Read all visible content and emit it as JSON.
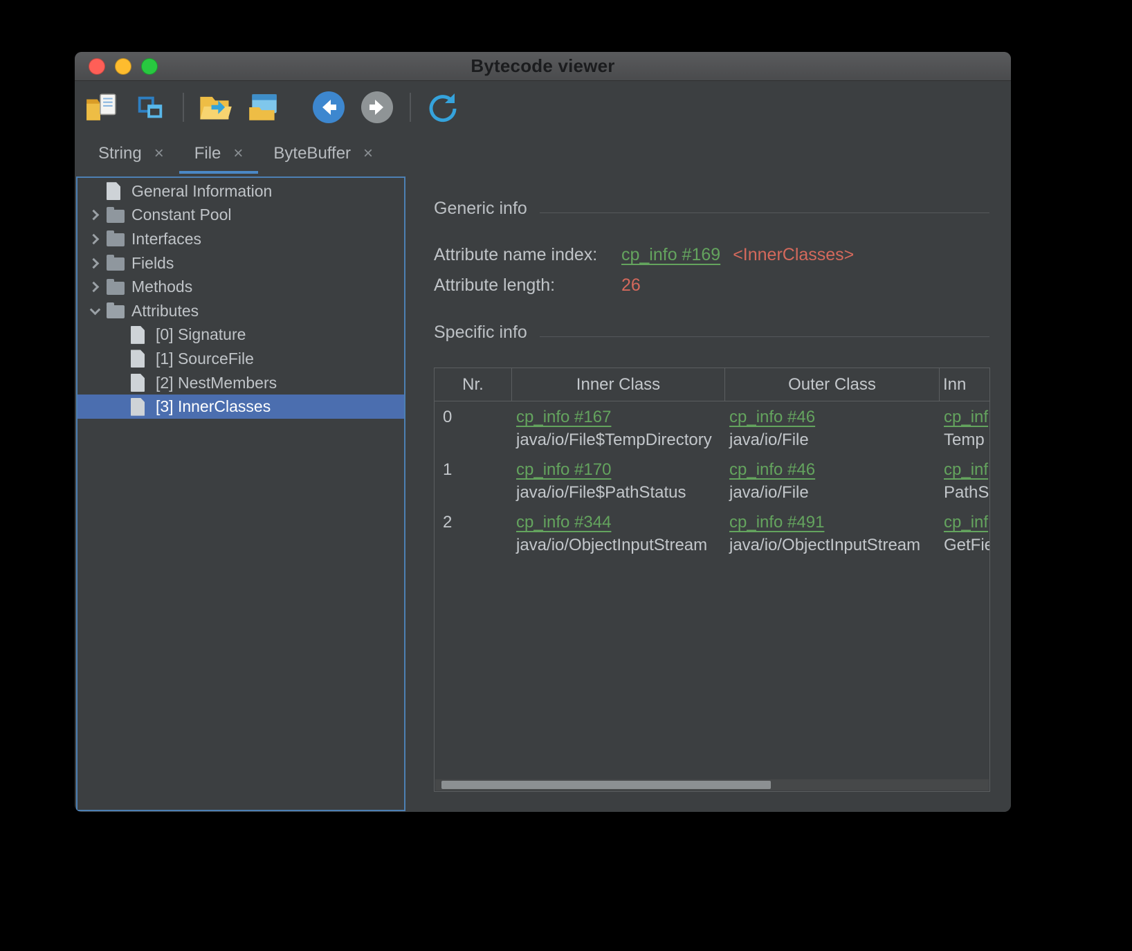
{
  "ui": {
    "close_glyph": "×"
  },
  "window": {
    "title": "Bytecode viewer"
  },
  "toolbar": {
    "icons": [
      "open-class-file",
      "new-window",
      "open-folder",
      "save",
      "back",
      "forward",
      "reload"
    ]
  },
  "tabs": [
    {
      "label": "String"
    },
    {
      "label": "File"
    },
    {
      "label": "ByteBuffer"
    }
  ],
  "tree": {
    "items": [
      {
        "label": "General Information",
        "icon": "document"
      },
      {
        "label": "Constant Pool",
        "icon": "folder",
        "state": "collapsed"
      },
      {
        "label": "Interfaces",
        "icon": "folder",
        "state": "collapsed"
      },
      {
        "label": "Fields",
        "icon": "folder",
        "state": "collapsed"
      },
      {
        "label": "Methods",
        "icon": "folder",
        "state": "collapsed"
      },
      {
        "label": "Attributes",
        "icon": "folder-open",
        "state": "expanded"
      },
      {
        "label": "[0] Signature",
        "icon": "document"
      },
      {
        "label": "[1] SourceFile",
        "icon": "document"
      },
      {
        "label": "[2] NestMembers",
        "icon": "document"
      },
      {
        "label": "[3] InnerClasses",
        "icon": "document",
        "selected": true
      }
    ]
  },
  "detail": {
    "generic_heading": "Generic info",
    "attribute_name": {
      "label": "Attribute name index:",
      "link": "cp_info #169",
      "resolved": "<InnerClasses>"
    },
    "attribute_length": {
      "label": "Attribute length:",
      "value": "26"
    },
    "specific_heading": "Specific info",
    "table": {
      "headers": [
        "Nr.",
        "Inner Class",
        "Outer Class",
        "Inn"
      ],
      "rows": [
        {
          "nr": "0",
          "inner_link": "cp_info #167",
          "inner_name": "java/io/File$TempDirectory",
          "outer_link": "cp_info #46",
          "outer_name": "java/io/File",
          "name_link": "cp_inf",
          "name_text": "Temp"
        },
        {
          "nr": "1",
          "inner_link": "cp_info #170",
          "inner_name": "java/io/File$PathStatus",
          "outer_link": "cp_info #46",
          "outer_name": "java/io/File",
          "name_link": "cp_inf",
          "name_text": "PathS"
        },
        {
          "nr": "2",
          "inner_link": "cp_info #344",
          "inner_name": "java/io/ObjectInputStream",
          "outer_link": "cp_info #491",
          "outer_name": "java/io/ObjectInputStream",
          "name_link": "cp_inf",
          "name_text": "GetFie"
        }
      ]
    }
  },
  "colors": {
    "accent_blue": "#4a88c7",
    "selection_blue": "#4b6eaf",
    "link_green": "#64a45e",
    "value_red": "#d4695c",
    "background": "#3c3f41"
  }
}
